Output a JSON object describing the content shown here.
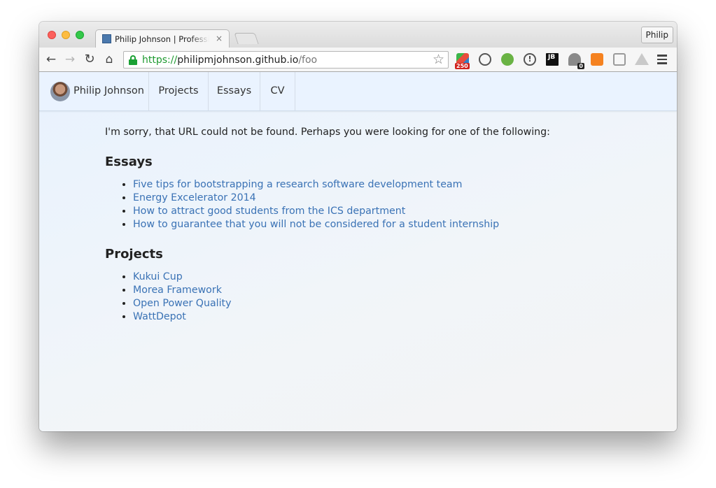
{
  "browser": {
    "tab_title": "Philip Johnson | Professional Portfolio",
    "tab_close_icon": "×",
    "profile_label": "Philip",
    "url_scheme": "https://",
    "url_host": "philipmjohnson.github.io",
    "url_path": "/foo",
    "ext_badge_count": "250",
    "ext_ghostery_count": "0",
    "ext_jetbrains_label": "JB",
    "ext_info_label": "!",
    "icons": {
      "back": "←",
      "forward": "→",
      "reload": "↻",
      "home": "⌂",
      "star": "☆"
    }
  },
  "site": {
    "brand_name": "Philip Johnson",
    "nav": {
      "projects": "Projects",
      "essays": "Essays",
      "cv": "CV"
    }
  },
  "page": {
    "intro": "I'm sorry, that URL could not be found. Perhaps you were looking for one of the following:",
    "essays_heading": "Essays",
    "essays": [
      "Five tips for bootstrapping a research software development team",
      "Energy Excelerator 2014",
      "How to attract good students from the ICS department",
      "How to guarantee that you will not be considered for a student internship"
    ],
    "projects_heading": "Projects",
    "projects": [
      "Kukui Cup",
      "Morea Framework",
      "Open Power Quality",
      "WattDepot"
    ]
  },
  "colors": {
    "link": "#3a72b5",
    "secure_green": "#1e9a30",
    "nav_background": "#eaf3ff"
  }
}
